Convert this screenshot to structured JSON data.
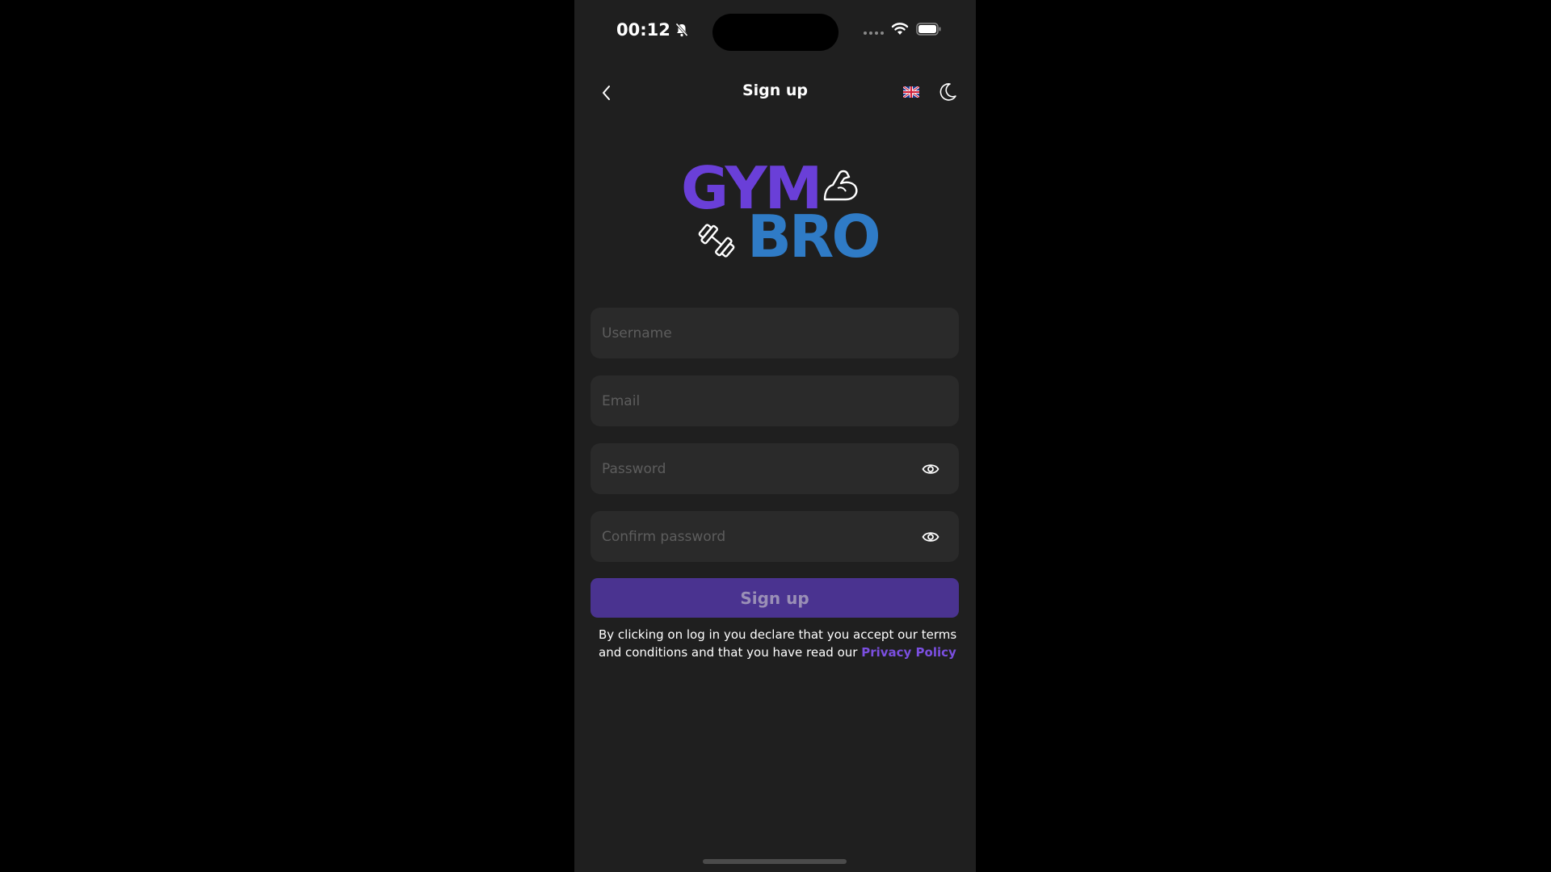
{
  "status_bar": {
    "time": "00:12",
    "icons": [
      "bell-slash-icon",
      "signal-dots-icon",
      "wifi-icon",
      "battery-icon"
    ]
  },
  "header": {
    "title": "Sign up",
    "back_icon": "chevron-left-icon",
    "language_icon": "uk-flag-icon",
    "theme_icon": "moon-icon"
  },
  "logo": {
    "line1": "GYM",
    "line2": "BRO",
    "colors": {
      "gym": "#6a3fd8",
      "bro": "#2f7bc6"
    }
  },
  "form": {
    "username_placeholder": "Username",
    "email_placeholder": "Email",
    "password_placeholder": "Password",
    "confirm_password_placeholder": "Confirm password",
    "submit_label": "Sign up"
  },
  "disclaimer": {
    "text": "By clicking on log in you declare that you accept our terms and conditions and that you have read our ",
    "link_label": "Privacy Policy"
  },
  "colors": {
    "background": "#1f1f1f",
    "field_bg": "#2a2a2a",
    "button_bg": "#4a3390",
    "link": "#7b4fe0"
  }
}
